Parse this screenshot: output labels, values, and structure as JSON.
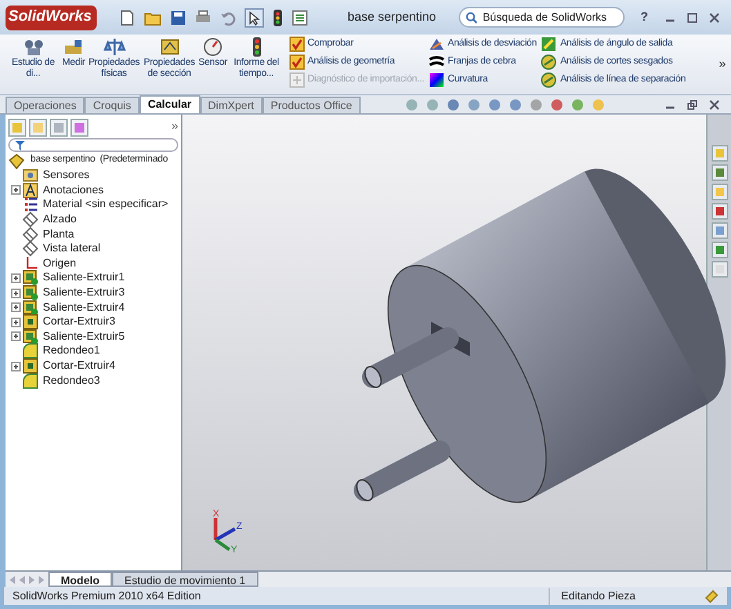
{
  "app": {
    "logo": "SolidWorks",
    "document_title": "base serpentino",
    "search_placeholder": "Búsqueda de SolidWorks",
    "help": "?"
  },
  "ribbon": {
    "buttons": [
      {
        "label": "Estudio de di..."
      },
      {
        "label": "Medir"
      },
      {
        "label": "Propiedades físicas"
      },
      {
        "label": "Propiedades de sección"
      },
      {
        "label": "Sensor"
      },
      {
        "label": "Informe del tiempo..."
      }
    ],
    "columns": [
      [
        {
          "label": "Comprobar",
          "disabled": false
        },
        {
          "label": "Análisis de geometría",
          "disabled": false
        },
        {
          "label": "Diagnóstico de importación...",
          "disabled": true
        }
      ],
      [
        {
          "label": "Análisis de desviación",
          "disabled": false
        },
        {
          "label": "Franjas de cebra",
          "disabled": false
        },
        {
          "label": "Curvatura",
          "disabled": false
        }
      ],
      [
        {
          "label": "Análisis de ángulo de salida",
          "disabled": false
        },
        {
          "label": "Análisis de cortes sesgados",
          "disabled": false
        },
        {
          "label": "Análisis de línea de separación",
          "disabled": false
        }
      ]
    ],
    "more": "»"
  },
  "tabs": [
    {
      "label": "Operaciones",
      "selected": false
    },
    {
      "label": "Croquis",
      "selected": false
    },
    {
      "label": "Calcular",
      "selected": true
    },
    {
      "label": "DimXpert",
      "selected": false
    },
    {
      "label": "Productos Office",
      "selected": false
    }
  ],
  "panel": {
    "more": "»",
    "root": "base serpentino  (Predeterminado",
    "tree": [
      {
        "label": "Sensores",
        "kind": "sensor",
        "has_children": false
      },
      {
        "label": "Anotaciones",
        "kind": "annotation",
        "has_children": true
      },
      {
        "label": "Material <sin especificar>",
        "kind": "material",
        "has_children": false
      },
      {
        "label": "Alzado",
        "kind": "plane",
        "has_children": false
      },
      {
        "label": "Planta",
        "kind": "plane",
        "has_children": false
      },
      {
        "label": "Vista lateral",
        "kind": "plane",
        "has_children": false
      },
      {
        "label": "Origen",
        "kind": "origin",
        "has_children": false
      },
      {
        "label": "Saliente-Extruir1",
        "kind": "boss",
        "has_children": true
      },
      {
        "label": "Saliente-Extruir3",
        "kind": "boss",
        "has_children": true
      },
      {
        "label": "Saliente-Extruir4",
        "kind": "boss",
        "has_children": true
      },
      {
        "label": "Cortar-Extruir3",
        "kind": "cut",
        "has_children": true
      },
      {
        "label": "Saliente-Extruir5",
        "kind": "boss",
        "has_children": true
      },
      {
        "label": "Redondeo1",
        "kind": "fillet",
        "has_children": false
      },
      {
        "label": "Cortar-Extruir4",
        "kind": "cut",
        "has_children": true
      },
      {
        "label": "Redondeo3",
        "kind": "fillet",
        "has_children": false
      }
    ]
  },
  "triad": {
    "x": "X",
    "y": "Y",
    "z": "Z"
  },
  "bottom_tabs": [
    {
      "label": "Modelo",
      "selected": true
    },
    {
      "label": "Estudio de movimiento 1",
      "selected": false
    }
  ],
  "status_bar": {
    "product": "SolidWorks Premium 2010 x64 Edition",
    "mode": "Editando Pieza"
  }
}
